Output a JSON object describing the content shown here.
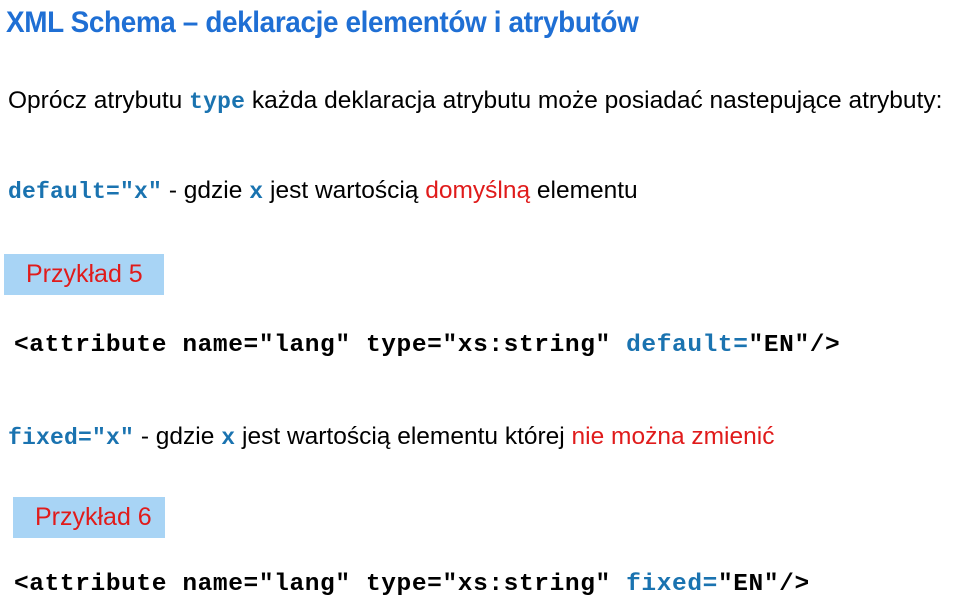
{
  "slide": {
    "title": "XML Schema – deklaracje elementów i atrybutów",
    "colors": {
      "title_blue": "#1F6FD4",
      "code_blue": "#1A73B0",
      "highlight_red": "#E01B1B",
      "example_box_blue": "#A8D4F5",
      "body_black": "#000000",
      "background": "#FFFFFF"
    }
  },
  "intro_paragraph": {
    "part1": "Oprócz atrybutu ",
    "code_type": "type",
    "part2": " każda deklaracja atrybutu może posiadać nastepujące atrybuty:"
  },
  "default_paragraph": {
    "code_default": "default=\"x\"",
    "part1": " - gdzie ",
    "code_x": "x",
    "part2": " jest wartością ",
    "red_text": "domyślną",
    "part3": " elementu"
  },
  "example_5": {
    "label": "Przykład 5"
  },
  "code_line_1": {
    "prefix": "<attribute name=\"lang\" type=\"xs:string\" ",
    "attribute": "default=",
    "suffix": "\"EN\"/>"
  },
  "fixed_paragraph": {
    "code_fixed": "fixed=\"x\"",
    "part1": " - gdzie ",
    "code_x": "x",
    "part2": " jest wartością elementu której ",
    "red_text": "nie można zmienić"
  },
  "example_6": {
    "label": "Przykład 6"
  },
  "code_line_2": {
    "prefix": "<attribute name=\"lang\" type=\"xs:string\" ",
    "attribute": "fixed=",
    "suffix": "\"EN\"/>"
  }
}
